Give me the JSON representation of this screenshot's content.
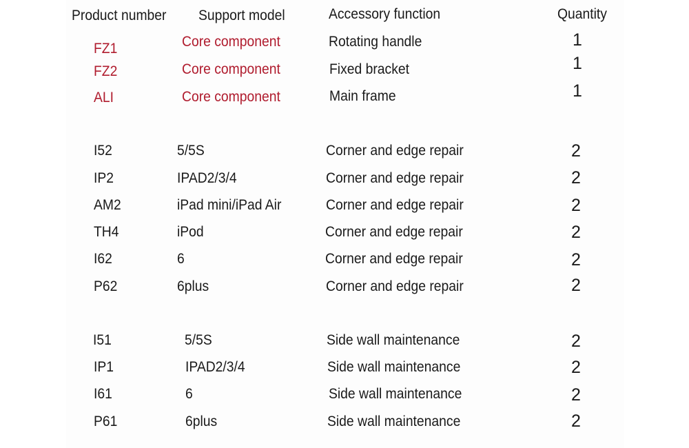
{
  "headers": {
    "product_number": "Product number",
    "support_model": "Support model",
    "accessory_function": "Accessory function",
    "quantity": "Quantity"
  },
  "colors": {
    "core_text": "#b01c2e",
    "normal_text": "#1a1a1a"
  },
  "groups": [
    {
      "rows": [
        {
          "product": "FZ1",
          "model": "Core component",
          "function": "Rotating handle",
          "qty": "1",
          "highlight": true
        },
        {
          "product": "FZ2",
          "model": "Core component",
          "function": "Fixed bracket",
          "qty": "1",
          "highlight": true
        },
        {
          "product": "ALI",
          "model": "Core component",
          "function": "Main frame",
          "qty": "1",
          "highlight": true
        }
      ]
    },
    {
      "rows": [
        {
          "product": "I52",
          "model": "5/5S",
          "function": "Corner and edge repair",
          "qty": "2"
        },
        {
          "product": "IP2",
          "model": "IPAD2/3/4",
          "function": "Corner and edge repair",
          "qty": "2"
        },
        {
          "product": "AM2",
          "model": "iPad mini/iPad Air",
          "function": "Corner and edge repair",
          "qty": "2"
        },
        {
          "product": "TH4",
          "model": "iPod",
          "function": "Corner and edge repair",
          "qty": "2"
        },
        {
          "product": "I62",
          "model": "6",
          "function": "Corner and edge repair",
          "qty": "2"
        },
        {
          "product": "P62",
          "model": "6plus",
          "function": "Corner and edge repair",
          "qty": "2"
        }
      ]
    },
    {
      "rows": [
        {
          "product": "I51",
          "model": "5/5S",
          "function": "Side wall maintenance",
          "qty": "2"
        },
        {
          "product": "IP1",
          "model": "IPAD2/3/4",
          "function": "Side wall maintenance",
          "qty": "2"
        },
        {
          "product": "I61",
          "model": "6",
          "function": "Side wall maintenance",
          "qty": "2"
        },
        {
          "product": "P61",
          "model": "6plus",
          "function": "Side wall maintenance",
          "qty": "2"
        }
      ]
    }
  ]
}
